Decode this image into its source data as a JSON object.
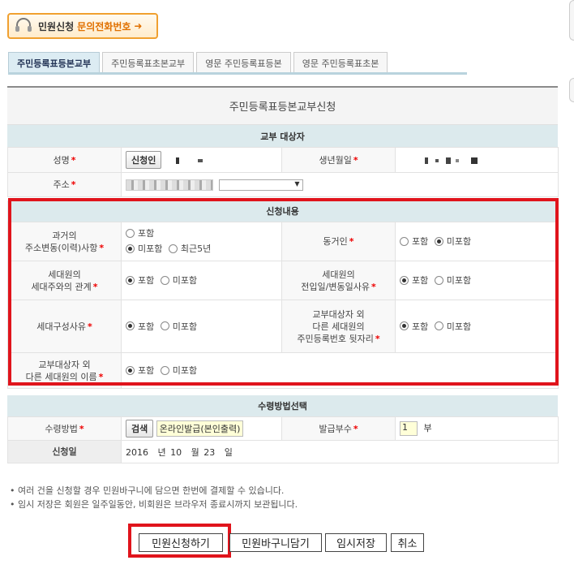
{
  "help_button": {
    "text1": "민원신청",
    "text2": "문의전화번호",
    "arrow": "➜"
  },
  "tabs": [
    {
      "label": "주민등록표등본교부",
      "active": true
    },
    {
      "label": "주민등록표초본교부",
      "active": false
    },
    {
      "label": "영문 주민등록표등본",
      "active": false
    },
    {
      "label": "영문 주민등록표초본",
      "active": false
    }
  ],
  "form_title": "주민등록표등본교부신청",
  "target_section": {
    "header": "교부 대상자",
    "name_label": "성명",
    "verify_button": "신청인",
    "birth_label": "생년월일",
    "address_label": "주소",
    "address_select_arrow": "▼"
  },
  "content_section": {
    "header": "신청내용",
    "rows": [
      {
        "left_label": [
          "과거의",
          "주소변동(이력)사항"
        ],
        "left_options": [
          {
            "label": "포함",
            "checked": false
          },
          {
            "label": "미포함",
            "checked": true
          },
          {
            "label": "최근5년",
            "checked": false
          }
        ],
        "right_label": [
          "동거인"
        ],
        "right_options": [
          {
            "label": "포함",
            "checked": false
          },
          {
            "label": "미포함",
            "checked": true
          }
        ]
      },
      {
        "left_label": [
          "세대원의",
          "세대주와의 관계"
        ],
        "left_options": [
          {
            "label": "포함",
            "checked": true
          },
          {
            "label": "미포함",
            "checked": false
          }
        ],
        "right_label": [
          "세대원의",
          "전입일/변동일사유"
        ],
        "right_options": [
          {
            "label": "포함",
            "checked": true
          },
          {
            "label": "미포함",
            "checked": false
          }
        ]
      },
      {
        "left_label": [
          "세대구성사유"
        ],
        "left_options": [
          {
            "label": "포함",
            "checked": true
          },
          {
            "label": "미포함",
            "checked": false
          }
        ],
        "right_label": [
          "교부대상자 외",
          "다른 세대원의",
          "주민등록번호 뒷자리"
        ],
        "right_options": [
          {
            "label": "포함",
            "checked": true
          },
          {
            "label": "미포함",
            "checked": false
          }
        ]
      },
      {
        "left_label": [
          "교부대상자 외",
          "다른 세대원의 이름"
        ],
        "left_options": [
          {
            "label": "포함",
            "checked": true
          },
          {
            "label": "미포함",
            "checked": false
          }
        ]
      }
    ]
  },
  "receipt_section": {
    "header": "수령방법선택",
    "method_label": "수령방법",
    "search_button": "검색",
    "method_value": "온라인발급(본인출력)",
    "copies_label": "발급부수",
    "copies_value": "1",
    "copies_unit": "부",
    "date_label": "신청일",
    "date_year": "2016",
    "date_year_unit": "년",
    "date_month": "10",
    "date_month_unit": "월",
    "date_day": "23",
    "date_day_unit": "일"
  },
  "notes": [
    "• 여러 건을 신청할 경우 민원바구니에 담으면 한번에 결제할 수 있습니다.",
    "• 임시 저장은 회원은 일주일동안, 비회원은 브라우저 종료시까지 보관됩니다."
  ],
  "buttons": {
    "apply": "민원신청하기",
    "basket": "민원바구니담기",
    "temp_save": "임시저장",
    "cancel": "취소"
  },
  "colors": {
    "highlight_frame": "#e0141c",
    "section_header_bg": "#dceaed",
    "required_star": "#e00000"
  }
}
